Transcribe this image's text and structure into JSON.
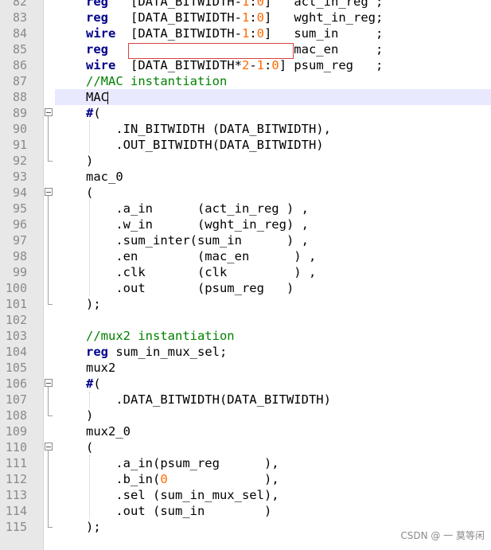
{
  "lines": [
    {
      "n": "82",
      "segs": [
        [
          "kw",
          "reg"
        ],
        [
          "pl",
          "   ["
        ],
        [
          "pl",
          "DATA_BITWIDTH-"
        ],
        [
          "num",
          "1"
        ],
        [
          "pl",
          ":"
        ],
        [
          "num",
          "0"
        ],
        [
          "pl",
          "]   act_in_reg ;"
        ]
      ]
    },
    {
      "n": "83",
      "segs": [
        [
          "kw",
          "reg"
        ],
        [
          "pl",
          "   [DATA_BITWIDTH-"
        ],
        [
          "num",
          "1"
        ],
        [
          "pl",
          ":"
        ],
        [
          "num",
          "0"
        ],
        [
          "pl",
          "]   wght_in_reg;"
        ]
      ]
    },
    {
      "n": "84",
      "segs": [
        [
          "kw",
          "wire"
        ],
        [
          "pl",
          "  [DATA_BITWIDTH-"
        ],
        [
          "num",
          "1"
        ],
        [
          "pl",
          ":"
        ],
        [
          "num",
          "0"
        ],
        [
          "pl",
          "]   sum_in     ;"
        ]
      ]
    },
    {
      "n": "85",
      "segs": [
        [
          "kw",
          "reg"
        ],
        [
          "pl",
          "                         mac_en     ;"
        ]
      ]
    },
    {
      "n": "86",
      "segs": [
        [
          "kw",
          "wire"
        ],
        [
          "pl",
          "  [DATA_BITWIDTH*"
        ],
        [
          "num",
          "2"
        ],
        [
          "pl",
          "-"
        ],
        [
          "num",
          "1"
        ],
        [
          "pl",
          ":"
        ],
        [
          "num",
          "0"
        ],
        [
          "pl",
          "] psum_reg   ;"
        ]
      ]
    },
    {
      "n": "87",
      "segs": [
        [
          "cm",
          "//MAC instantiation"
        ]
      ]
    },
    {
      "n": "88",
      "segs": [
        [
          "pl",
          "MAC"
        ]
      ],
      "current": true
    },
    {
      "n": "89",
      "segs": [
        [
          "kw",
          "#"
        ],
        [
          "pl",
          "("
        ]
      ]
    },
    {
      "n": "90",
      "segs": [
        [
          "pl",
          "    .IN_BITWIDTH (DATA_BITWIDTH),"
        ]
      ]
    },
    {
      "n": "91",
      "segs": [
        [
          "pl",
          "    .OUT_BITWIDTH(DATA_BITWIDTH)"
        ]
      ]
    },
    {
      "n": "92",
      "segs": [
        [
          "pl",
          ")"
        ]
      ]
    },
    {
      "n": "93",
      "segs": [
        [
          "pl",
          "mac_0"
        ]
      ]
    },
    {
      "n": "94",
      "segs": [
        [
          "pl",
          "("
        ]
      ]
    },
    {
      "n": "95",
      "segs": [
        [
          "pl",
          "    .a_in      (act_in_reg ) ,"
        ]
      ]
    },
    {
      "n": "96",
      "segs": [
        [
          "pl",
          "    .w_in      (wght_in_reg) ,"
        ]
      ]
    },
    {
      "n": "97",
      "segs": [
        [
          "pl",
          "    .sum_inter(sum_in      ) ,"
        ]
      ]
    },
    {
      "n": "98",
      "segs": [
        [
          "pl",
          "    .en        (mac_en      ) ,"
        ]
      ]
    },
    {
      "n": "99",
      "segs": [
        [
          "pl",
          "    .clk       (clk         ) ,"
        ]
      ]
    },
    {
      "n": "100",
      "segs": [
        [
          "pl",
          "    .out       (psum_reg   )"
        ]
      ]
    },
    {
      "n": "101",
      "segs": [
        [
          "pl",
          ");"
        ]
      ]
    },
    {
      "n": "102",
      "segs": []
    },
    {
      "n": "103",
      "segs": [
        [
          "cm",
          "//mux2 instantiation"
        ]
      ]
    },
    {
      "n": "104",
      "segs": [
        [
          "kw",
          "reg"
        ],
        [
          "pl",
          " sum_in_mux_sel;"
        ]
      ]
    },
    {
      "n": "105",
      "segs": [
        [
          "pl",
          "mux2"
        ]
      ]
    },
    {
      "n": "106",
      "segs": [
        [
          "kw",
          "#"
        ],
        [
          "pl",
          "("
        ]
      ]
    },
    {
      "n": "107",
      "segs": [
        [
          "pl",
          "    .DATA_BITWIDTH(DATA_BITWIDTH)"
        ]
      ]
    },
    {
      "n": "108",
      "segs": [
        [
          "pl",
          ")"
        ]
      ]
    },
    {
      "n": "109",
      "segs": [
        [
          "pl",
          "mux2_0"
        ]
      ]
    },
    {
      "n": "110",
      "segs": [
        [
          "pl",
          "("
        ]
      ]
    },
    {
      "n": "111",
      "segs": [
        [
          "pl",
          "    .a_in(psum_reg      ),"
        ]
      ]
    },
    {
      "n": "112",
      "segs": [
        [
          "pl",
          "    .b_in("
        ],
        [
          "num",
          "0"
        ],
        [
          "pl",
          "             ),"
        ]
      ]
    },
    {
      "n": "113",
      "segs": [
        [
          "pl",
          "    .sel (sum_in_mux_sel),"
        ]
      ]
    },
    {
      "n": "114",
      "segs": [
        [
          "pl",
          "    .out (sum_in        )"
        ]
      ]
    },
    {
      "n": "115",
      "segs": [
        [
          "pl",
          ");"
        ]
      ]
    }
  ],
  "watermark": "CSDN @ 一 莫等闲"
}
